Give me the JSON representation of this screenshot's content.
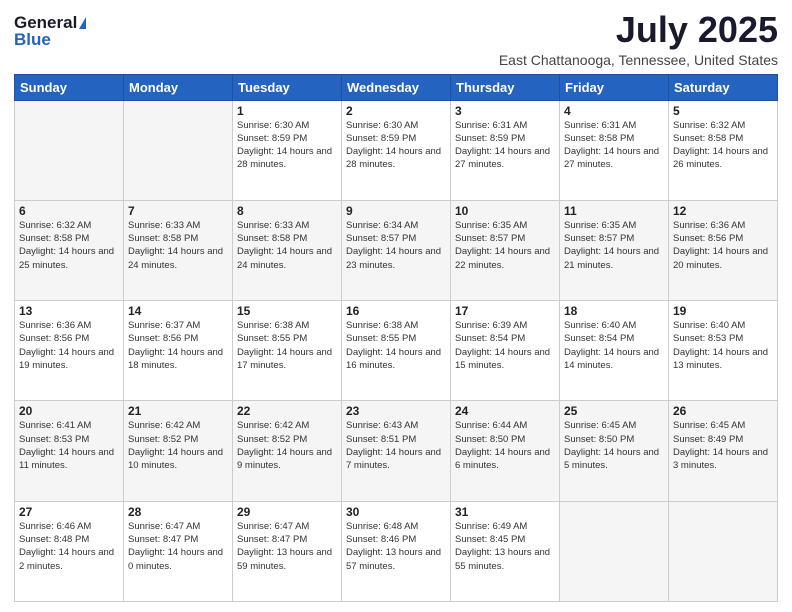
{
  "logo": {
    "general": "General",
    "blue": "Blue"
  },
  "title": "July 2025",
  "subtitle": "East Chattanooga, Tennessee, United States",
  "days_header": [
    "Sunday",
    "Monday",
    "Tuesday",
    "Wednesday",
    "Thursday",
    "Friday",
    "Saturday"
  ],
  "weeks": [
    [
      {
        "num": "",
        "info": ""
      },
      {
        "num": "",
        "info": ""
      },
      {
        "num": "1",
        "info": "Sunrise: 6:30 AM\nSunset: 8:59 PM\nDaylight: 14 hours and 28 minutes."
      },
      {
        "num": "2",
        "info": "Sunrise: 6:30 AM\nSunset: 8:59 PM\nDaylight: 14 hours and 28 minutes."
      },
      {
        "num": "3",
        "info": "Sunrise: 6:31 AM\nSunset: 8:59 PM\nDaylight: 14 hours and 27 minutes."
      },
      {
        "num": "4",
        "info": "Sunrise: 6:31 AM\nSunset: 8:58 PM\nDaylight: 14 hours and 27 minutes."
      },
      {
        "num": "5",
        "info": "Sunrise: 6:32 AM\nSunset: 8:58 PM\nDaylight: 14 hours and 26 minutes."
      }
    ],
    [
      {
        "num": "6",
        "info": "Sunrise: 6:32 AM\nSunset: 8:58 PM\nDaylight: 14 hours and 25 minutes."
      },
      {
        "num": "7",
        "info": "Sunrise: 6:33 AM\nSunset: 8:58 PM\nDaylight: 14 hours and 24 minutes."
      },
      {
        "num": "8",
        "info": "Sunrise: 6:33 AM\nSunset: 8:58 PM\nDaylight: 14 hours and 24 minutes."
      },
      {
        "num": "9",
        "info": "Sunrise: 6:34 AM\nSunset: 8:57 PM\nDaylight: 14 hours and 23 minutes."
      },
      {
        "num": "10",
        "info": "Sunrise: 6:35 AM\nSunset: 8:57 PM\nDaylight: 14 hours and 22 minutes."
      },
      {
        "num": "11",
        "info": "Sunrise: 6:35 AM\nSunset: 8:57 PM\nDaylight: 14 hours and 21 minutes."
      },
      {
        "num": "12",
        "info": "Sunrise: 6:36 AM\nSunset: 8:56 PM\nDaylight: 14 hours and 20 minutes."
      }
    ],
    [
      {
        "num": "13",
        "info": "Sunrise: 6:36 AM\nSunset: 8:56 PM\nDaylight: 14 hours and 19 minutes."
      },
      {
        "num": "14",
        "info": "Sunrise: 6:37 AM\nSunset: 8:56 PM\nDaylight: 14 hours and 18 minutes."
      },
      {
        "num": "15",
        "info": "Sunrise: 6:38 AM\nSunset: 8:55 PM\nDaylight: 14 hours and 17 minutes."
      },
      {
        "num": "16",
        "info": "Sunrise: 6:38 AM\nSunset: 8:55 PM\nDaylight: 14 hours and 16 minutes."
      },
      {
        "num": "17",
        "info": "Sunrise: 6:39 AM\nSunset: 8:54 PM\nDaylight: 14 hours and 15 minutes."
      },
      {
        "num": "18",
        "info": "Sunrise: 6:40 AM\nSunset: 8:54 PM\nDaylight: 14 hours and 14 minutes."
      },
      {
        "num": "19",
        "info": "Sunrise: 6:40 AM\nSunset: 8:53 PM\nDaylight: 14 hours and 13 minutes."
      }
    ],
    [
      {
        "num": "20",
        "info": "Sunrise: 6:41 AM\nSunset: 8:53 PM\nDaylight: 14 hours and 11 minutes."
      },
      {
        "num": "21",
        "info": "Sunrise: 6:42 AM\nSunset: 8:52 PM\nDaylight: 14 hours and 10 minutes."
      },
      {
        "num": "22",
        "info": "Sunrise: 6:42 AM\nSunset: 8:52 PM\nDaylight: 14 hours and 9 minutes."
      },
      {
        "num": "23",
        "info": "Sunrise: 6:43 AM\nSunset: 8:51 PM\nDaylight: 14 hours and 7 minutes."
      },
      {
        "num": "24",
        "info": "Sunrise: 6:44 AM\nSunset: 8:50 PM\nDaylight: 14 hours and 6 minutes."
      },
      {
        "num": "25",
        "info": "Sunrise: 6:45 AM\nSunset: 8:50 PM\nDaylight: 14 hours and 5 minutes."
      },
      {
        "num": "26",
        "info": "Sunrise: 6:45 AM\nSunset: 8:49 PM\nDaylight: 14 hours and 3 minutes."
      }
    ],
    [
      {
        "num": "27",
        "info": "Sunrise: 6:46 AM\nSunset: 8:48 PM\nDaylight: 14 hours and 2 minutes."
      },
      {
        "num": "28",
        "info": "Sunrise: 6:47 AM\nSunset: 8:47 PM\nDaylight: 14 hours and 0 minutes."
      },
      {
        "num": "29",
        "info": "Sunrise: 6:47 AM\nSunset: 8:47 PM\nDaylight: 13 hours and 59 minutes."
      },
      {
        "num": "30",
        "info": "Sunrise: 6:48 AM\nSunset: 8:46 PM\nDaylight: 13 hours and 57 minutes."
      },
      {
        "num": "31",
        "info": "Sunrise: 6:49 AM\nSunset: 8:45 PM\nDaylight: 13 hours and 55 minutes."
      },
      {
        "num": "",
        "info": ""
      },
      {
        "num": "",
        "info": ""
      }
    ]
  ]
}
